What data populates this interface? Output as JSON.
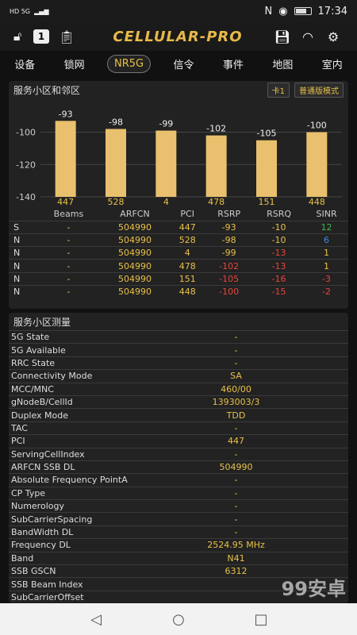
{
  "status": {
    "time": "17:34",
    "left_label": "HD 5G"
  },
  "app": {
    "title": "CELLULAR-PRO",
    "badge_count": "1"
  },
  "tabs": [
    "设备",
    "锁网",
    "NR5G",
    "信令",
    "事件",
    "地图",
    "室内"
  ],
  "active_tab": "NR5G",
  "neighbors": {
    "title": "服务小区和邻区",
    "sim_label": "卡1",
    "mode_label": "普通版模式",
    "chart_data": {
      "type": "bar",
      "categories": [
        "447",
        "528",
        "4",
        "478",
        "151",
        "448"
      ],
      "values": [
        -93,
        -98,
        -99,
        -102,
        -105,
        -100
      ],
      "ylim": [
        -140,
        -85
      ],
      "yticks": [
        -100,
        -120,
        -140
      ],
      "bar_color": "#e9c06d"
    },
    "headers": [
      "",
      "Beams",
      "ARFCN",
      "PCI",
      "RSRP",
      "RSRQ",
      "SINR"
    ],
    "rows": [
      {
        "type": "S",
        "beams": "-",
        "arfcn": "504990",
        "pci": "447",
        "rsrp": "-93",
        "rsrq": "-10",
        "sinr": "12",
        "rsrp_color": "yellow",
        "rsrq_color": "yellow",
        "sinr_color": "green"
      },
      {
        "type": "N",
        "beams": "-",
        "arfcn": "504990",
        "pci": "528",
        "rsrp": "-98",
        "rsrq": "-10",
        "sinr": "6",
        "rsrp_color": "yellow",
        "rsrq_color": "yellow",
        "sinr_color": "blue"
      },
      {
        "type": "N",
        "beams": "-",
        "arfcn": "504990",
        "pci": "4",
        "rsrp": "-99",
        "rsrq": "-13",
        "sinr": "1",
        "rsrp_color": "yellow",
        "rsrq_color": "red",
        "sinr_color": "yellow"
      },
      {
        "type": "N",
        "beams": "-",
        "arfcn": "504990",
        "pci": "478",
        "rsrp": "-102",
        "rsrq": "-13",
        "sinr": "1",
        "rsrp_color": "red",
        "rsrq_color": "red",
        "sinr_color": "yellow"
      },
      {
        "type": "N",
        "beams": "-",
        "arfcn": "504990",
        "pci": "151",
        "rsrp": "-105",
        "rsrq": "-16",
        "sinr": "-3",
        "rsrp_color": "red",
        "rsrq_color": "red",
        "sinr_color": "red"
      },
      {
        "type": "N",
        "beams": "-",
        "arfcn": "504990",
        "pci": "448",
        "rsrp": "-100",
        "rsrq": "-15",
        "sinr": "-2",
        "rsrp_color": "red",
        "rsrq_color": "red",
        "sinr_color": "red"
      }
    ]
  },
  "measurement": {
    "title": "服务小区测量",
    "rows": [
      {
        "label": "5G State",
        "value": "-"
      },
      {
        "label": "5G Available",
        "value": "-"
      },
      {
        "label": "RRC State",
        "value": "-"
      },
      {
        "label": "Connectivity Mode",
        "value": "SA"
      },
      {
        "label": "MCC/MNC",
        "value": "460/00"
      },
      {
        "label": "gNodeB/CellId",
        "value": "1393003/3"
      },
      {
        "label": "Duplex Mode",
        "value": "TDD"
      },
      {
        "label": "TAC",
        "value": "-"
      },
      {
        "label": "PCI",
        "value": "447"
      },
      {
        "label": "ServingCellIndex",
        "value": "-"
      },
      {
        "label": "ARFCN SSB DL",
        "value": "504990"
      },
      {
        "label": "Absolute Frequency PointA",
        "value": "-"
      },
      {
        "label": "CP Type",
        "value": "-"
      },
      {
        "label": "Numerology",
        "value": "-"
      },
      {
        "label": "SubCarrierSpacing",
        "value": "-"
      },
      {
        "label": "BandWidth DL",
        "value": "-"
      },
      {
        "label": "Frequency DL",
        "value": "2524.95 MHz"
      },
      {
        "label": "Band",
        "value": "N41"
      },
      {
        "label": "SSB GSCN",
        "value": "6312"
      },
      {
        "label": "SSB Beam Index",
        "value": ""
      },
      {
        "label": "SubCarrierOffset",
        "value": ""
      }
    ]
  },
  "watermark": "99安卓"
}
